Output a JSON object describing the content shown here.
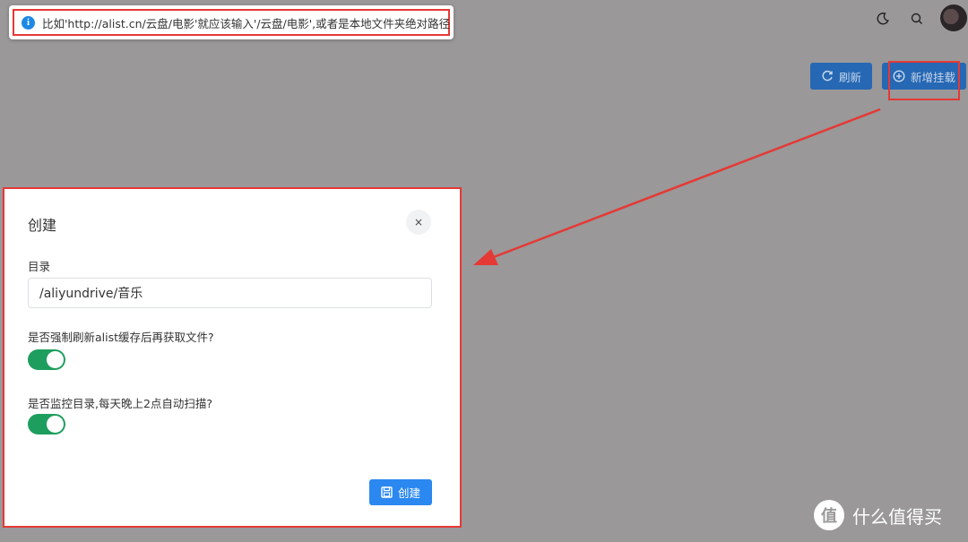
{
  "tooltip": {
    "icon": "info-icon",
    "text": "比如'http://alist.cn/云盘/电影'就应该输入'/云盘/电影',或者是本地文件夹绝对路径"
  },
  "header": {
    "icons": [
      "moon-icon",
      "search-icon"
    ],
    "avatar": "avatar"
  },
  "toolbar": {
    "refresh_label": "刷新",
    "add_label": "新增挂载"
  },
  "modal": {
    "title": "创建",
    "close_label": "×",
    "dir_label": "目录",
    "dir_value": "/aliyundrive/音乐",
    "refresh_label": "是否强制刷新alist缓存后再获取文件?",
    "refresh_on": true,
    "monitor_label": "是否监控目录,每天晚上2点自动扫描?",
    "monitor_on": true,
    "create_label": "创建"
  },
  "colors": {
    "accent": "#2b88f0",
    "toggle_on": "#1e9e5e",
    "highlight": "#e53935"
  },
  "watermark": {
    "logo_text": "值",
    "text": "什么值得买"
  }
}
